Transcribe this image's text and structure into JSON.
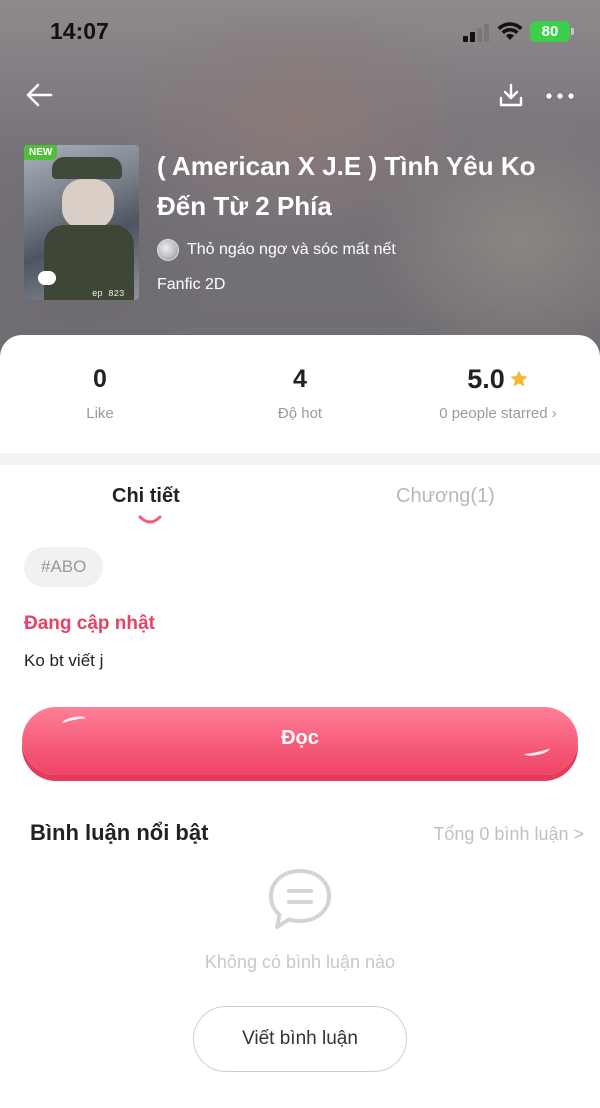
{
  "status_bar": {
    "time": "14:07",
    "battery": "80"
  },
  "header": {
    "cover_badge": "NEW",
    "cover_caption": "ep 823",
    "title": "( American X J.E ) Tình Yêu Ko Đến Từ 2 Phía",
    "author": "Thỏ ngáo ngơ và sóc mất nết",
    "genre": "Fanfic 2D"
  },
  "stats": {
    "likes": {
      "value": "0",
      "label": "Like"
    },
    "hot": {
      "value": "4",
      "label": "Độ hot"
    },
    "rating": {
      "value": "5.0",
      "label": "0 people starred ›"
    }
  },
  "tabs": {
    "detail": "Chi tiết",
    "chapters": "Chương(1)"
  },
  "detail": {
    "tag": "#ABO",
    "status": "Đang cập nhật",
    "description": "Ko bt viết j"
  },
  "read_button": "Đọc",
  "comments": {
    "title": "Bình luận nổi bật",
    "total": "Tổng 0 bình luận >",
    "empty": "Không có bình luận nào",
    "write_button": "Viết bình luận"
  },
  "colors": {
    "accent": "#f55a79",
    "status_text": "#e6436a",
    "star": "#f7b731",
    "battery": "#3ecf4a"
  }
}
